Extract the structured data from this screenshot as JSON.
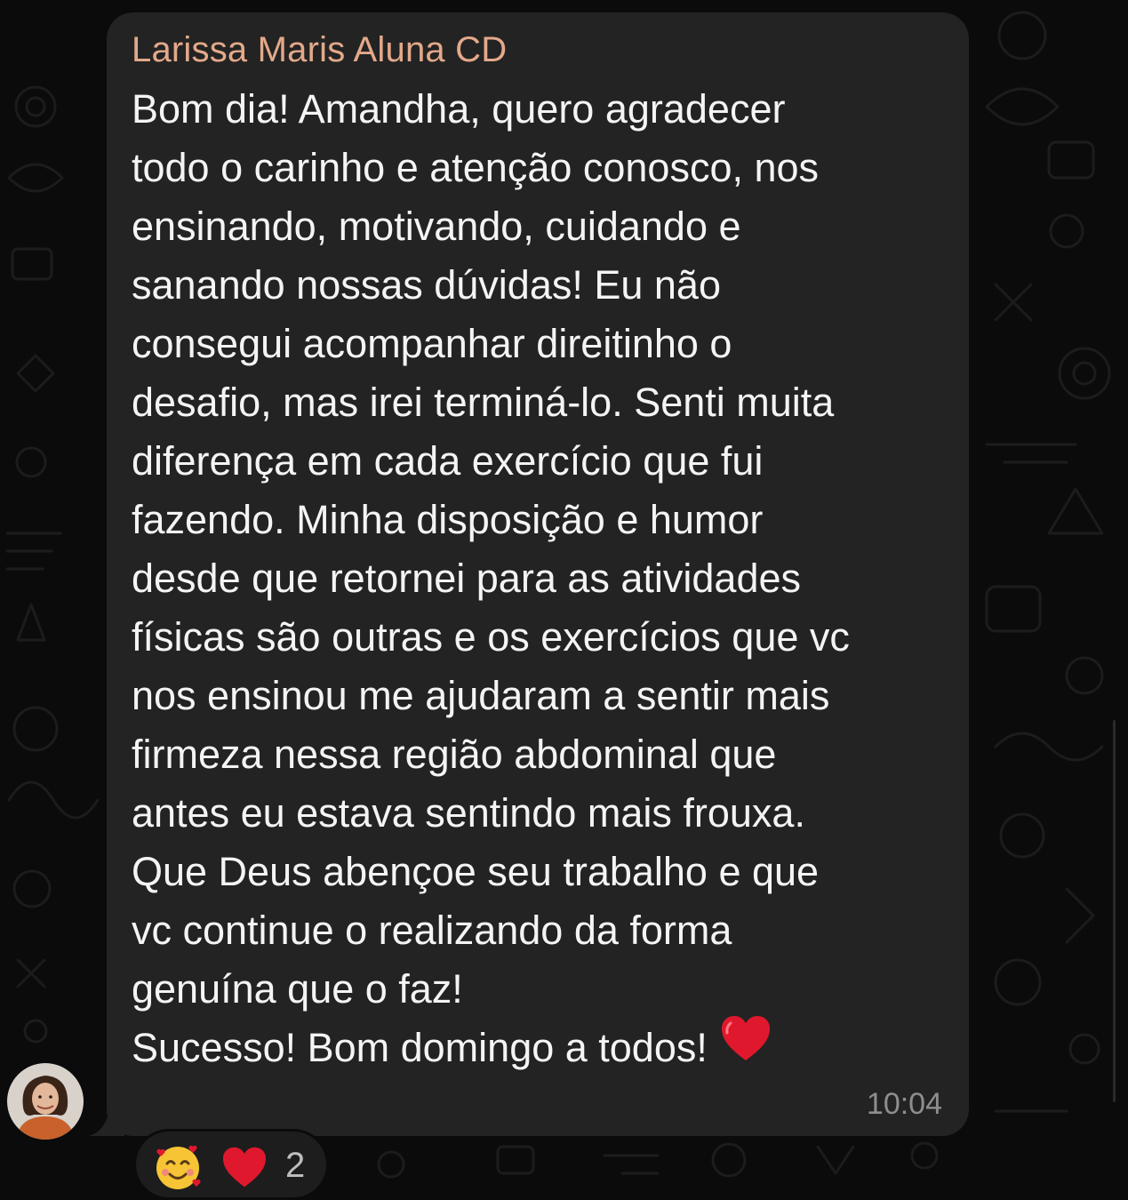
{
  "chat": {
    "message": {
      "sender": "Larissa Maris Aluna CD",
      "lines": [
        "Bom dia! Amandha, quero agradecer",
        "todo o carinho e atenção conosco, nos",
        "ensinando, motivando, cuidando e",
        "sanando nossas dúvidas! Eu não",
        "consegui acompanhar direitinho o",
        "desafio, mas irei terminá-lo. Senti muita",
        "diferença em cada exercício que fui",
        "fazendo. Minha disposição e humor",
        "desde que retornei para as atividades",
        "físicas são outras e os exercícios que vc",
        "nos ensinou me ajudaram a sentir mais",
        "firmeza nessa região abdominal que",
        "antes eu estava sentindo mais frouxa.",
        "Que Deus abençoe seu trabalho e que",
        "vc continue o realizando da forma",
        "genuína que o faz!"
      ],
      "last_line": "Sucesso! Bom domingo a todos!",
      "time": "10:04"
    },
    "reactions": {
      "items": [
        {
          "icon": "smiling-face-with-hearts-icon"
        },
        {
          "icon": "red-heart-icon"
        }
      ],
      "count": "2"
    }
  },
  "colors": {
    "background": "#0b0b0b",
    "bubble": "#232323",
    "sender_name": "#e3a98a",
    "message_text": "#f4f4f4",
    "timestamp": "#8e8e8e",
    "heart": "#e0182d"
  }
}
